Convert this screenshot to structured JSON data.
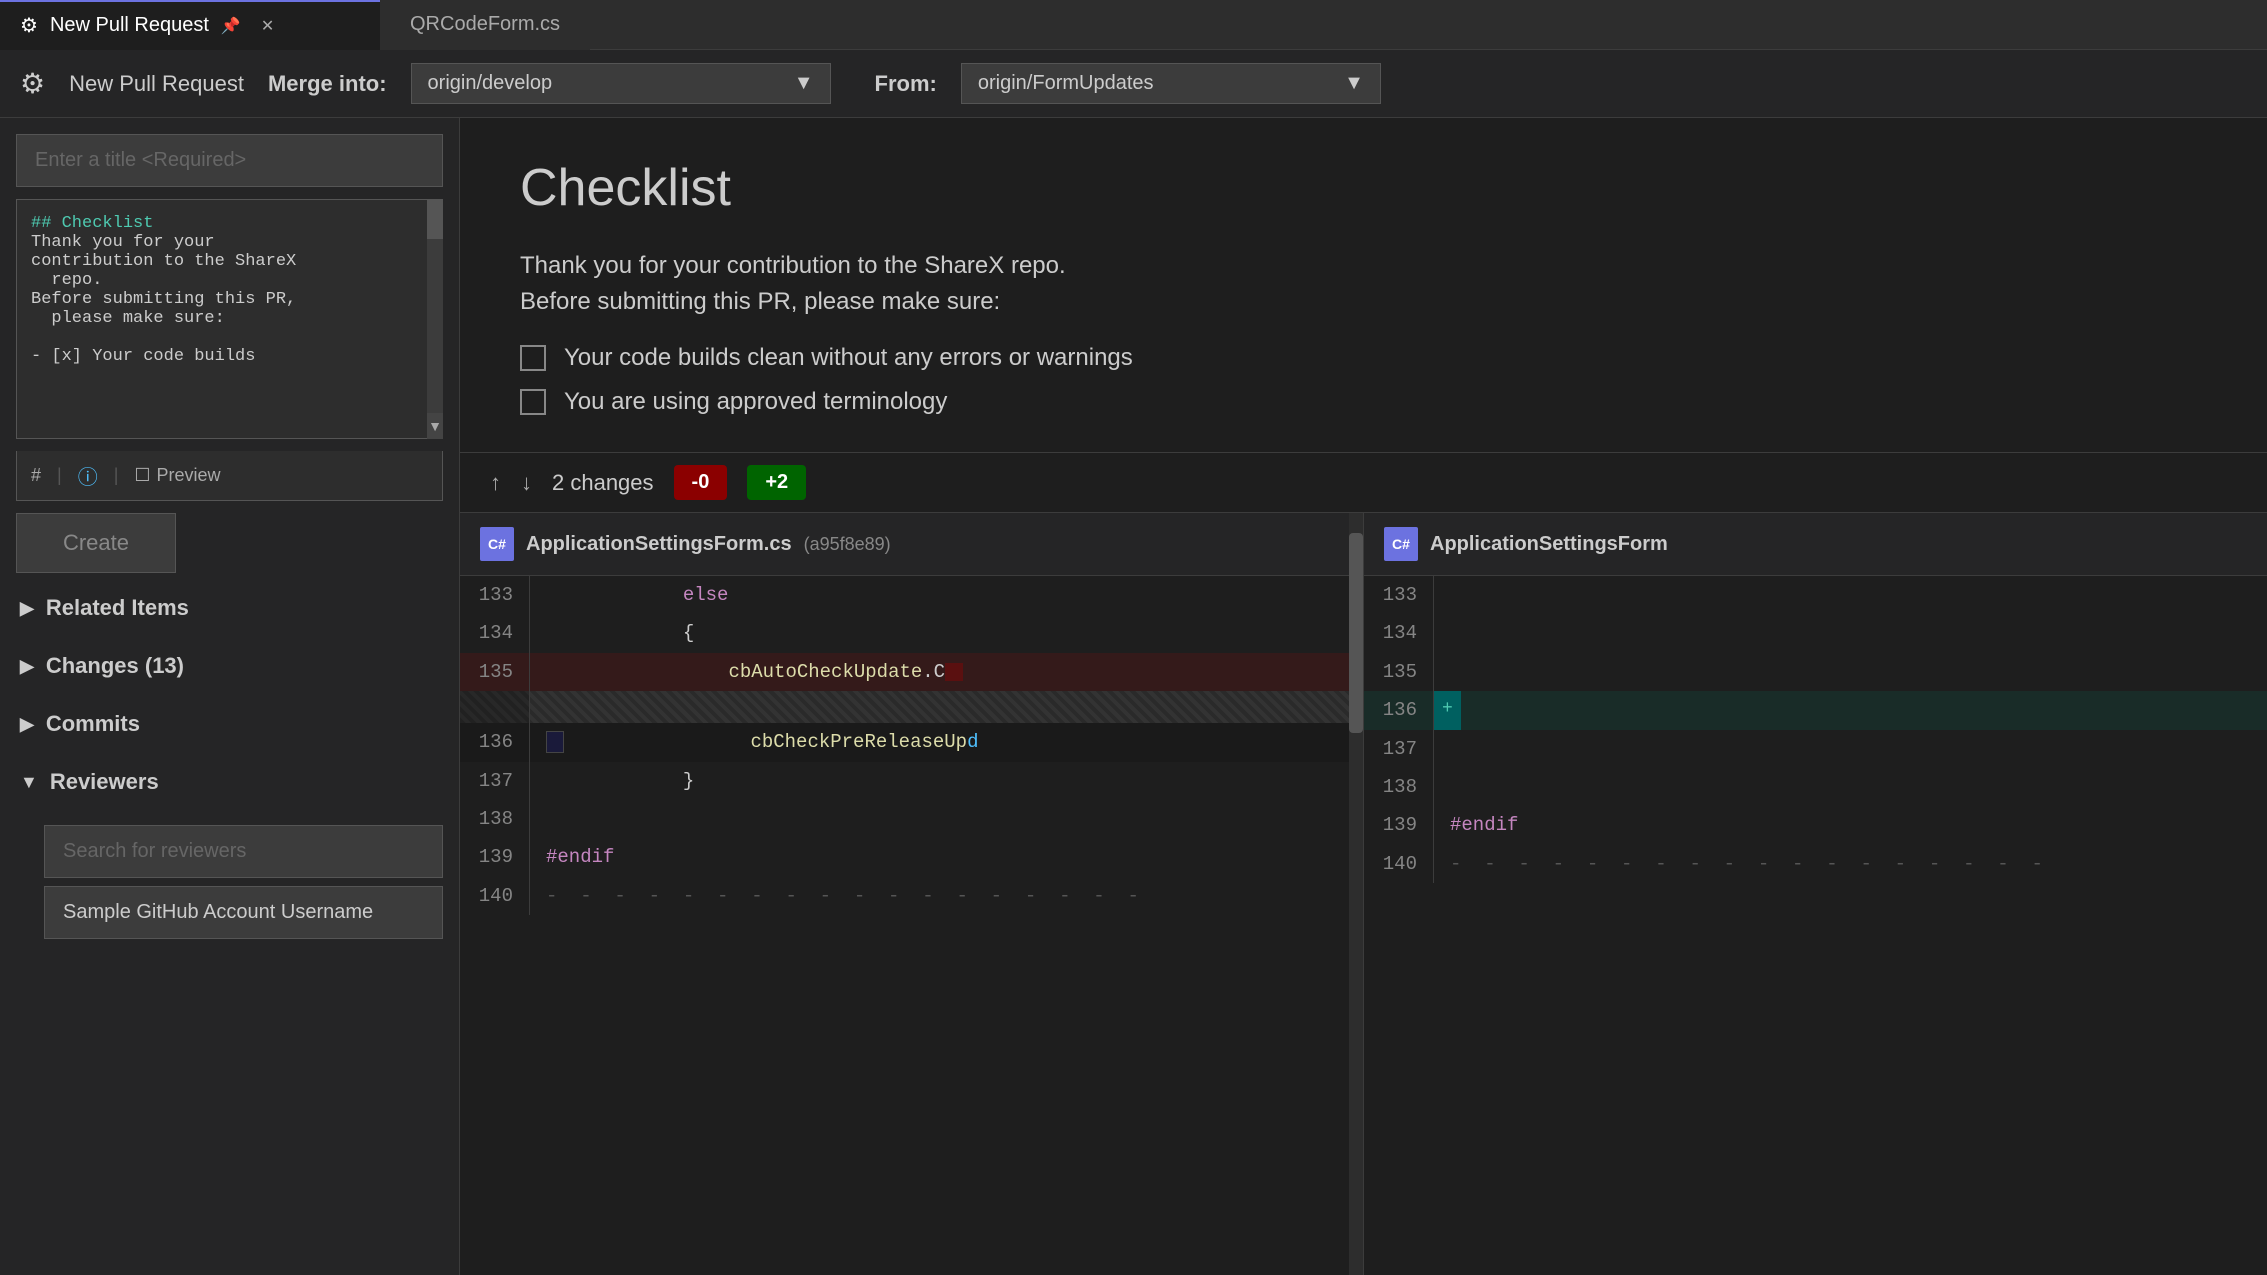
{
  "titlebar": {
    "active_tab": "New Pull Request",
    "inactive_tab": "QRCodeForm.cs",
    "pin_icon": "📌",
    "close_icon": "✕"
  },
  "toolbar": {
    "icon": "⚙",
    "title": "New Pull Request",
    "merge_label": "Merge into:",
    "merge_into": "origin/develop",
    "from_label": "From:",
    "from_branch": "origin/FormUpdates"
  },
  "left_panel": {
    "title_placeholder": "Enter a title <Required>",
    "description_lines": [
      "## Checklist",
      "Thank you for your",
      "contribution to the ShareX",
      "  repo.",
      "Before submitting this PR,",
      "  please make sure:",
      "",
      "- [x] Your code builds"
    ],
    "desc_toolbar": {
      "hash_icon": "#",
      "info_icon": "ⓘ",
      "preview_icon": "👁",
      "preview_label": "Preview"
    },
    "create_label": "Create",
    "sections": [
      {
        "label": "Related Items",
        "expanded": false
      },
      {
        "label": "Changes (13)",
        "expanded": false
      },
      {
        "label": "Commits",
        "expanded": false
      }
    ],
    "reviewers_section": {
      "label": "Reviewers",
      "expanded": true,
      "search_placeholder": "Search for reviewers",
      "reviewer_name": "Sample GitHub Account Username"
    }
  },
  "right_panel": {
    "preview_title": "Checklist",
    "preview_intro_1": "Thank you for your contribution to the ShareX repo.",
    "preview_intro_2": "Before submitting this PR, please make sure:",
    "checklist_items": [
      "Your code builds clean without any errors or warnings",
      "You are using approved terminology"
    ],
    "diff_bar": {
      "up_arrow": "↑",
      "down_arrow": "↓",
      "changes_label": "2 changes",
      "badge_red": "-0",
      "badge_green": "+2"
    },
    "diff_left": {
      "cs_label": "C#",
      "filename": "ApplicationSettingsForm.cs",
      "hash": "(a95f8e89)",
      "lines": [
        {
          "num": "133",
          "content": "            else",
          "type": "normal"
        },
        {
          "num": "134",
          "content": "            {",
          "type": "normal"
        },
        {
          "num": "135",
          "content": "                cbAutoCheckUpdate.C",
          "type": "deleted"
        },
        {
          "num": "",
          "content": "",
          "type": "empty"
        },
        {
          "num": "136",
          "content": "                cbCheckPreReleaseUp",
          "type": "modified"
        },
        {
          "num": "137",
          "content": "            }",
          "type": "normal"
        },
        {
          "num": "138",
          "content": "",
          "type": "normal"
        },
        {
          "num": "139",
          "content": "#endif",
          "type": "normal"
        },
        {
          "num": "140",
          "content": "----------------------------",
          "type": "separator"
        }
      ]
    },
    "diff_right": {
      "cs_label": "C#",
      "filename": "ApplicationSettingsForm",
      "lines": [
        {
          "num": "133",
          "content": "",
          "type": "normal"
        },
        {
          "num": "134",
          "content": "",
          "type": "normal"
        },
        {
          "num": "135",
          "content": "",
          "type": "normal"
        },
        {
          "num": "136",
          "content": "+",
          "type": "added"
        },
        {
          "num": "137",
          "content": "",
          "type": "normal"
        },
        {
          "num": "138",
          "content": "",
          "type": "normal"
        },
        {
          "num": "139",
          "content": "#endif",
          "type": "normal"
        },
        {
          "num": "140",
          "content": "----------------------------",
          "type": "separator"
        }
      ]
    }
  }
}
